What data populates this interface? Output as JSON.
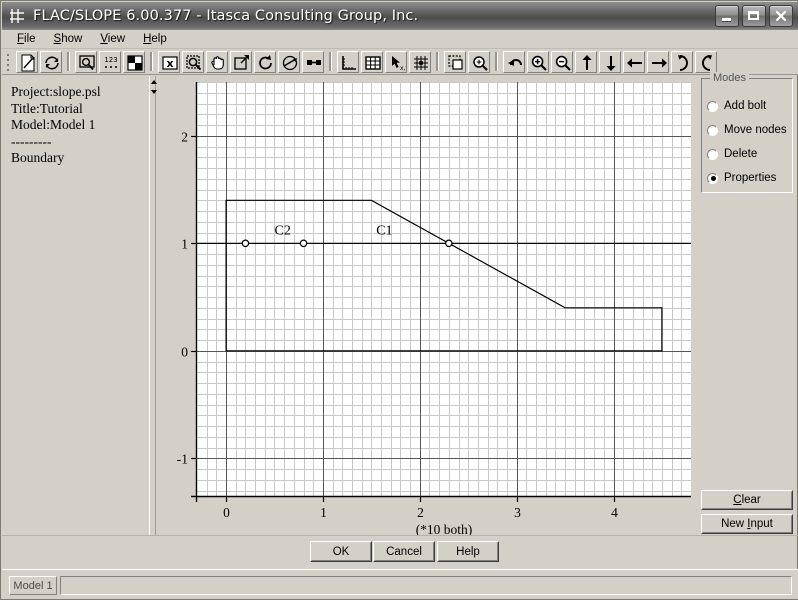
{
  "window": {
    "title": "FLAC/SLOPE 6.00.377 - Itasca Consulting Group, Inc.",
    "app_icon": "axes-icon",
    "minimize_label": "",
    "maximize_label": "",
    "close_label": "×"
  },
  "menubar": {
    "items": [
      {
        "label": "File",
        "accel": "F"
      },
      {
        "label": "Show",
        "accel": "S"
      },
      {
        "label": "View",
        "accel": "V"
      },
      {
        "label": "Help",
        "accel": "H"
      }
    ]
  },
  "toolbar": {
    "groups": [
      [
        "new-project-icon",
        "rebuild-icon"
      ],
      [
        "zoom-window-icon",
        "numbers-icon",
        "quad-view-icon"
      ],
      [
        "delete-x-icon",
        "zoom-box-icon",
        "pan-hand-icon",
        "resize-icon",
        "rotate-cw-icon",
        "rotate-3d-icon",
        "link-icon"
      ],
      [
        "axes-icon",
        "grid-icon",
        "pick-xy-icon",
        "snap-grid-icon"
      ],
      [
        "marquee-icon",
        "zoom-all-icon"
      ],
      [
        "undo-icon",
        "zoom-in-icon",
        "zoom-out-icon",
        "move-up-icon",
        "move-down-icon",
        "move-left-icon",
        "move-right-icon",
        "rotate-right-icon",
        "rotate-left-icon"
      ]
    ]
  },
  "left_panel": {
    "lines": [
      "Project:slope.psl",
      "Title:Tutorial",
      "Model:Model 1",
      "---------",
      "Boundary"
    ]
  },
  "modes_panel": {
    "title": "Modes",
    "options": [
      {
        "label": "Add bolt",
        "selected": false
      },
      {
        "label": "Move nodes",
        "selected": false
      },
      {
        "label": "Delete",
        "selected": false
      },
      {
        "label": "Properties",
        "selected": true
      }
    ],
    "clear_button": {
      "label": "Clear",
      "accel": "C"
    },
    "new_input_button": {
      "label": "New Input",
      "accel": "I"
    }
  },
  "dialog_buttons": [
    {
      "label": "OK",
      "name": "ok-button"
    },
    {
      "label": "Cancel",
      "name": "cancel-button"
    },
    {
      "label": "Help",
      "name": "help-button"
    }
  ],
  "statusbar": {
    "tab_label": "Model 1",
    "field_value": ""
  },
  "colors": {
    "window_bg": "#d4d0c8",
    "plot_bg": "#ffffff",
    "minor_grid": "#c8c8c8",
    "major_grid": "#555555",
    "geometry_line": "#000000",
    "title_text": "#ffffff"
  },
  "chart_data": {
    "type": "line",
    "title": "",
    "xlabel": "(*10 both)",
    "ylabel": "",
    "xlim": [
      -0.3,
      4.8
    ],
    "ylim": [
      -1.35,
      2.5
    ],
    "xticks": [
      0,
      1,
      2,
      3,
      4
    ],
    "xticklabels": [
      "0",
      "1",
      "2",
      "3",
      "4"
    ],
    "yticks": [
      -1,
      0,
      1,
      2
    ],
    "yticklabels": [
      "-1",
      "0",
      "1",
      "2"
    ],
    "grid": true,
    "minor_grid_step": 0.1,
    "major_grid_step": 1.0,
    "axis_scale_note": "(*10 both)",
    "series": [
      {
        "name": "slope-boundary",
        "type": "polyline",
        "closed": true,
        "points": [
          [
            0.0,
            0.0
          ],
          [
            0.0,
            1.4
          ],
          [
            1.5,
            1.4
          ],
          [
            3.5,
            0.4
          ],
          [
            4.5,
            0.4
          ],
          [
            4.5,
            0.0
          ]
        ]
      },
      {
        "name": "interface-line-C",
        "type": "polyline",
        "closed": false,
        "points": [
          [
            -0.3,
            1.0
          ],
          [
            4.8,
            1.0
          ]
        ]
      }
    ],
    "nodes": [
      {
        "x": 0.2,
        "y": 1.0
      },
      {
        "x": 0.8,
        "y": 1.0
      },
      {
        "x": 2.3,
        "y": 1.0
      }
    ],
    "annotations": [
      {
        "text": "C2",
        "x": 0.5,
        "y": 1.08
      },
      {
        "text": "C1",
        "x": 1.55,
        "y": 1.08
      }
    ]
  }
}
